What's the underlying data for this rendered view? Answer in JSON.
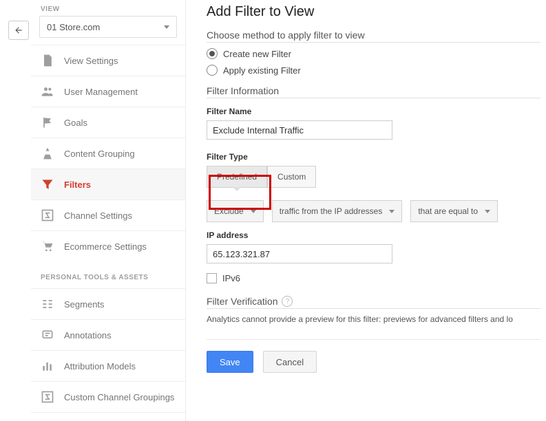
{
  "sidebar": {
    "view_label": "VIEW",
    "view_selected": "01 Store.com",
    "groups": [
      {
        "items": [
          {
            "label": "View Settings",
            "icon": "page"
          },
          {
            "label": "User Management",
            "icon": "users"
          },
          {
            "label": "Goals",
            "icon": "flag"
          },
          {
            "label": "Content Grouping",
            "icon": "grouping"
          },
          {
            "label": "Filters",
            "icon": "funnel",
            "active": true
          },
          {
            "label": "Channel Settings",
            "icon": "channel"
          },
          {
            "label": "Ecommerce Settings",
            "icon": "cart"
          }
        ]
      },
      {
        "label": "PERSONAL TOOLS & ASSETS",
        "items": [
          {
            "label": "Segments",
            "icon": "segments"
          },
          {
            "label": "Annotations",
            "icon": "annotation"
          },
          {
            "label": "Attribution Models",
            "icon": "bars"
          },
          {
            "label": "Custom Channel Groupings",
            "icon": "channel"
          }
        ]
      }
    ]
  },
  "main": {
    "title": "Add Filter to View",
    "method_head": "Choose method to apply filter to view",
    "radios": {
      "create": "Create new Filter",
      "apply": "Apply existing Filter",
      "selected": "create"
    },
    "filter_info_head": "Filter Information",
    "name_label": "Filter Name",
    "name_value": "Exclude Internal Traffic",
    "type_label": "Filter Type",
    "tabs": {
      "predefined": "Predefined",
      "custom": "Custom",
      "selected": "predefined"
    },
    "dropdowns": {
      "action": "Exclude",
      "source": "traffic from the IP addresses",
      "match": "that are equal to"
    },
    "ip_label": "IP address",
    "ip_value": "65.123.321.87",
    "ipv6_label": "IPv6",
    "verify_head": "Filter Verification",
    "verify_text": "Analytics cannot provide a preview for this filter: previews for advanced filters and lo",
    "buttons": {
      "save": "Save",
      "cancel": "Cancel"
    }
  }
}
